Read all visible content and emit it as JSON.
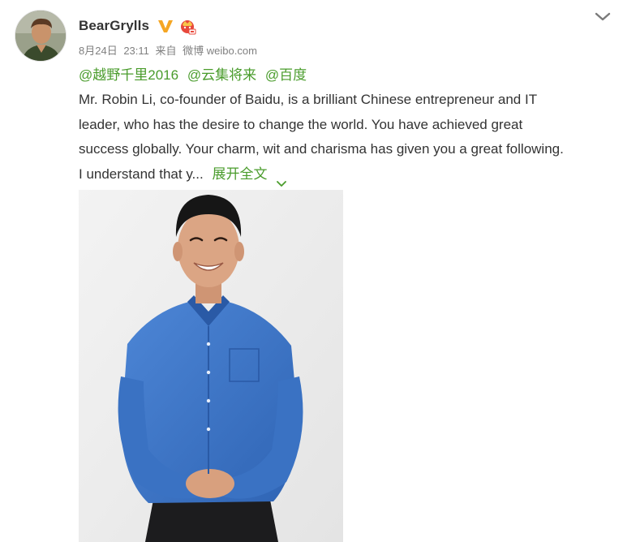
{
  "post": {
    "username": "BearGrylls",
    "date": "8月24日",
    "time": "23:11",
    "source_prefix": "来自",
    "source_name": "微博 weibo.com",
    "mentions": [
      "@越野千里2016",
      "@云集将来",
      "@百度"
    ],
    "text_lines": [
      "Mr. Robin Li, co-founder of Baidu, is a brilliant Chinese entrepreneur and IT",
      "leader, who has the desire to change the world. You have achieved great",
      "success globally. Your charm, wit and charisma has given you a great following.",
      "I understand that y..."
    ],
    "expand_label": "展开全文"
  },
  "icons": {
    "verified": "verified-v-icon",
    "member": "member-crown-icon",
    "menu": "chevron-down-icon",
    "expand": "expand-caret-icon"
  },
  "colors": {
    "link": "#4a9c2c",
    "verified": "#f5a623",
    "member": "#e8483b",
    "text": "#333333",
    "meta": "#808080",
    "shirt": "#3f78c9"
  }
}
